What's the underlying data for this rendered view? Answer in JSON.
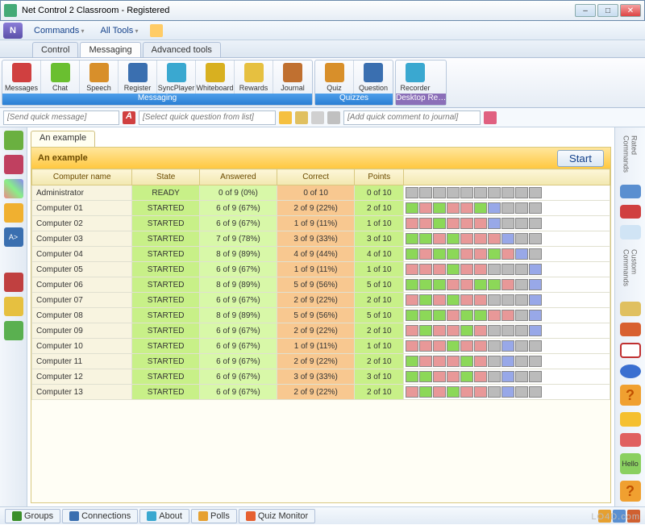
{
  "window": {
    "title": "Net Control 2 Classroom - Registered"
  },
  "menu": {
    "commands": "Commands",
    "alltools": "All Tools"
  },
  "tabs": {
    "control": "Control",
    "messaging": "Messaging",
    "advanced": "Advanced tools"
  },
  "toolbar": {
    "messaging": {
      "label": "Messaging",
      "items": [
        "Messages",
        "Chat",
        "Speech",
        "Register",
        "SyncPlayer",
        "Whiteboard",
        "Rewards",
        "Journal"
      ]
    },
    "quizzes": {
      "label": "Quizzes",
      "items": [
        "Quiz",
        "Question"
      ]
    },
    "desktop": {
      "label": "Desktop Re…",
      "items": [
        "Recorder"
      ]
    },
    "colors": [
      "#d04040",
      "#6abf30",
      "#d88f2a",
      "#3a6fb0",
      "#3aa8d0",
      "#d8b020",
      "#e6c040",
      "#c07030"
    ]
  },
  "quickbar": {
    "send_msg": "[Send quick message]",
    "quick_q": "[Select quick question from list]",
    "journal": "[Add quick comment to journal]"
  },
  "panel": {
    "tab": "An example",
    "title": "An example",
    "start": "Start"
  },
  "columns": [
    "Computer name",
    "State",
    "Answered",
    "Correct",
    "Points"
  ],
  "rows": [
    {
      "name": "Administrator",
      "state": "READY",
      "ans": "0 of 9 (0%)",
      "corr": "0 of 10",
      "pts": "0 of 10",
      "sq": ""
    },
    {
      "name": "Computer 01",
      "state": "STARTED",
      "ans": "6 of 9 (67%)",
      "corr": "2 of 9 (22%)",
      "pts": "2 of 10",
      "sq": "grgrrgbxxx"
    },
    {
      "name": "Computer 02",
      "state": "STARTED",
      "ans": "6 of 9 (67%)",
      "corr": "1 of 9 (11%)",
      "pts": "1 of 10",
      "sq": "rrgrrrbxxx"
    },
    {
      "name": "Computer 03",
      "state": "STARTED",
      "ans": "7 of 9 (78%)",
      "corr": "3 of 9 (33%)",
      "pts": "3 of 10",
      "sq": "ggrgrrrbxx"
    },
    {
      "name": "Computer 04",
      "state": "STARTED",
      "ans": "8 of 9 (89%)",
      "corr": "4 of 9 (44%)",
      "pts": "4 of 10",
      "sq": "grggrrgrbx"
    },
    {
      "name": "Computer 05",
      "state": "STARTED",
      "ans": "6 of 9 (67%)",
      "corr": "1 of 9 (11%)",
      "pts": "1 of 10",
      "sq": "rrrgrrxxxb"
    },
    {
      "name": "Computer 06",
      "state": "STARTED",
      "ans": "8 of 9 (89%)",
      "corr": "5 of 9 (56%)",
      "pts": "5 of 10",
      "sq": "gggrrggrxb"
    },
    {
      "name": "Computer 07",
      "state": "STARTED",
      "ans": "6 of 9 (67%)",
      "corr": "2 of 9 (22%)",
      "pts": "2 of 10",
      "sq": "rgrgrrxxxb"
    },
    {
      "name": "Computer 08",
      "state": "STARTED",
      "ans": "8 of 9 (89%)",
      "corr": "5 of 9 (56%)",
      "pts": "5 of 10",
      "sq": "gggrggrrxb"
    },
    {
      "name": "Computer 09",
      "state": "STARTED",
      "ans": "6 of 9 (67%)",
      "corr": "2 of 9 (22%)",
      "pts": "2 of 10",
      "sq": "rgrrgrxxxb"
    },
    {
      "name": "Computer 10",
      "state": "STARTED",
      "ans": "6 of 9 (67%)",
      "corr": "1 of 9 (11%)",
      "pts": "1 of 10",
      "sq": "rrrgrrxbxx"
    },
    {
      "name": "Computer 11",
      "state": "STARTED",
      "ans": "6 of 9 (67%)",
      "corr": "2 of 9 (22%)",
      "pts": "2 of 10",
      "sq": "grrrgrxbxx"
    },
    {
      "name": "Computer 12",
      "state": "STARTED",
      "ans": "6 of 9 (67%)",
      "corr": "3 of 9 (33%)",
      "pts": "3 of 10",
      "sq": "ggrrgrxbxx"
    },
    {
      "name": "Computer 13",
      "state": "STARTED",
      "ans": "6 of 9 (67%)",
      "corr": "2 of 9 (22%)",
      "pts": "2 of 10",
      "sq": "rgrgrrxbxx"
    }
  ],
  "status_tabs": [
    "Groups",
    "Connections",
    "About",
    "Polls",
    "Quiz Monitor"
  ],
  "status_colors": [
    "#3a8f2a",
    "#3a6fb0",
    "#3aa8d0",
    "#e6a030",
    "#e66030"
  ],
  "right": {
    "rated": "Rated Commands",
    "custom": "Custom Commands"
  },
  "watermark": "LO4D.com"
}
